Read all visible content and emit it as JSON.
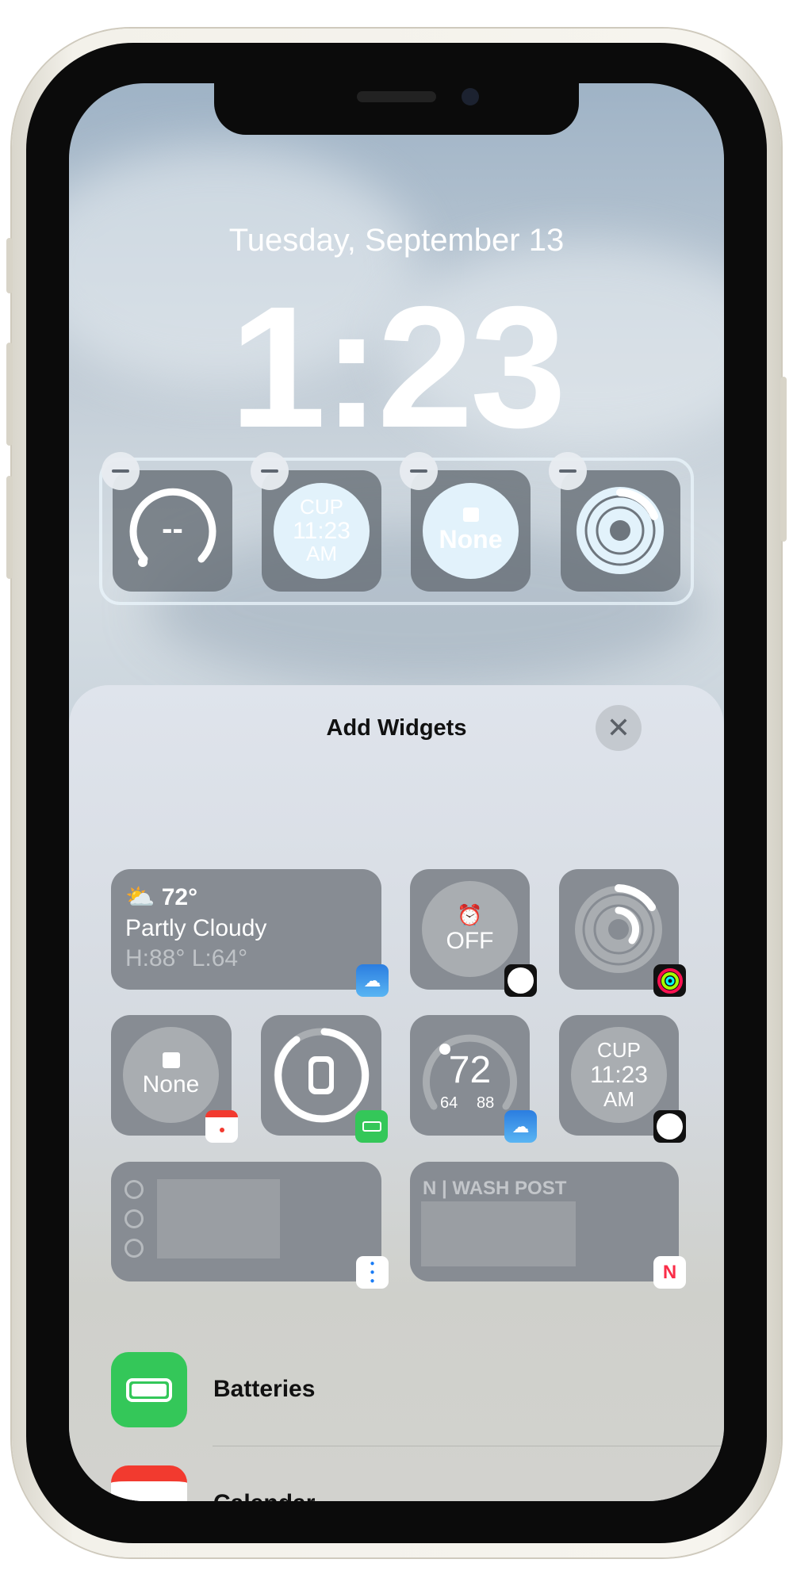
{
  "lock_screen": {
    "date": "Tuesday, September 13",
    "time": "1:23",
    "widgets": [
      {
        "name": "weather-gauge",
        "value": "--"
      },
      {
        "name": "world-clock",
        "city": "CUP",
        "time": "11:23",
        "ampm": "AM"
      },
      {
        "name": "calendar",
        "value": "None"
      },
      {
        "name": "activity-rings"
      }
    ]
  },
  "sheet": {
    "title": "Add Widgets",
    "close_icon": "xmark",
    "widgets": {
      "weather": {
        "temp": "72°",
        "condition": "Partly Cloudy",
        "hilo": "H:88° L:64°",
        "app": "Weather"
      },
      "alarm": {
        "value": "OFF",
        "app": "Clock"
      },
      "activity": {
        "app": "Fitness"
      },
      "calendar": {
        "value": "None",
        "app": "Calendar"
      },
      "batteries": {
        "app": "Batteries"
      },
      "temperature": {
        "value": "72",
        "low": "64",
        "high": "88",
        "app": "Weather"
      },
      "world_clock": {
        "city": "CUP",
        "time": "11:23",
        "ampm": "AM",
        "app": "Clock"
      },
      "reminders": {
        "app": "Reminders"
      },
      "news": {
        "source": "| WASH POST",
        "app": "News"
      }
    },
    "apps": [
      {
        "label": "Batteries"
      },
      {
        "label": "Calendar"
      }
    ]
  },
  "colors": {
    "batteries_green": "#34c759",
    "calendar_red": "#f23a2f",
    "frame": "#f3f1ea"
  }
}
